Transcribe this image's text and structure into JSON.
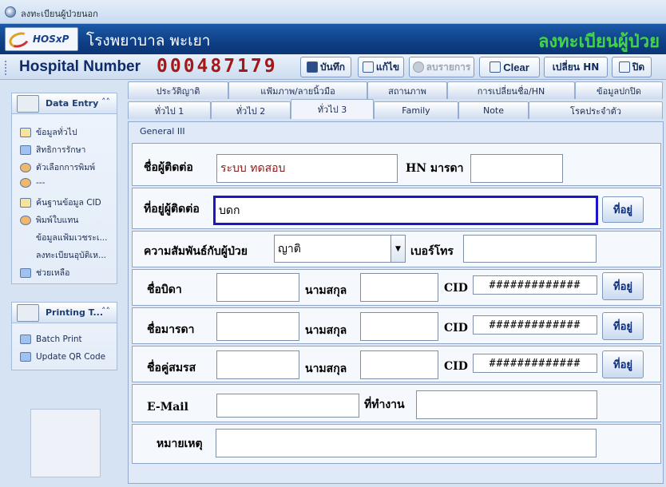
{
  "window": {
    "title": "ลงทะเบียนผู้ป่วยนอก"
  },
  "banner": {
    "logo_text": "HOSxP",
    "hospital_name": "โรงพยาบาล พะเยา",
    "page_title": "ลงทะเบียนผู้ป่วย"
  },
  "toolbar": {
    "hn_label": "Hospital Number",
    "hn_value": "000487179",
    "save": "บันทึก",
    "edit": "แก้ไข",
    "delete": "ลบรายการ",
    "clear": "Clear",
    "change_hn": "เปลี่ยน HN",
    "close": "ปิด"
  },
  "sidebar": {
    "data_entry": {
      "title": "Data Entry",
      "items": [
        {
          "label": "ข้อมูลทั่วไป"
        },
        {
          "label": "สิทธิการรักษา"
        },
        {
          "label": "ตัวเลือกการพิมพ์"
        },
        {
          "label": "---"
        },
        {
          "label": "ค้นฐานข้อมูล CID"
        },
        {
          "label": "พิมพ์ใบแทน"
        },
        {
          "label": "ข้อมูลแฟ้มเวชระเ..."
        },
        {
          "label": "ลงทะเบียนอุบัติเห..."
        },
        {
          "label": "ช่วยเหลือ"
        }
      ]
    },
    "printing": {
      "title": "Printing T...",
      "items": [
        {
          "label": "Batch Print"
        },
        {
          "label": "Update QR Code"
        }
      ]
    }
  },
  "tabs": {
    "row1": [
      "ประวัติญาติ",
      "แฟ้มภาพ/ลายนิ้วมือ",
      "สถานภาพ",
      "การเปลี่ยนชื่อ/HN",
      "ข้อมูลปกปิด"
    ],
    "row2": [
      "ทั่วไป 1",
      "ทั่วไป 2",
      "ทั่วไป 3",
      "Family",
      "Note",
      "โรคประจำตัว"
    ],
    "active": "ทั่วไป 3"
  },
  "content": {
    "group_label": "General III",
    "contact_name_label": "ชื่อผู้ติดต่อ",
    "contact_name_value": "ระบบ  ทดสอบ",
    "mother_hn_label": "HN มารดา",
    "mother_hn_value": "",
    "contact_address_label": "ที่อยู่ผู้ติดต่อ",
    "contact_address_value": "บดก",
    "address_button": "ที่อยู่",
    "relation_label": "ความสัมพันธ์กับผู้ป่วย",
    "relation_value": "ญาติ",
    "phone_label": "เบอร์โทร",
    "phone_value": "",
    "father_label": "ชื่อบิดา",
    "mother_label": "ชื่อมารดา",
    "spouse_label": "ชื่อคู่สมรส",
    "surname_label": "นามสกุล",
    "cid_label": "CID",
    "cid_mask": "#############",
    "email_label": "E-Mail",
    "workplace_label": "ที่ทำงาน",
    "note_label": "หมายเหตุ"
  },
  "colors": {
    "banner_title": "#43d346",
    "hn_digits": "#a31818",
    "focus_border": "#1a17c9"
  }
}
